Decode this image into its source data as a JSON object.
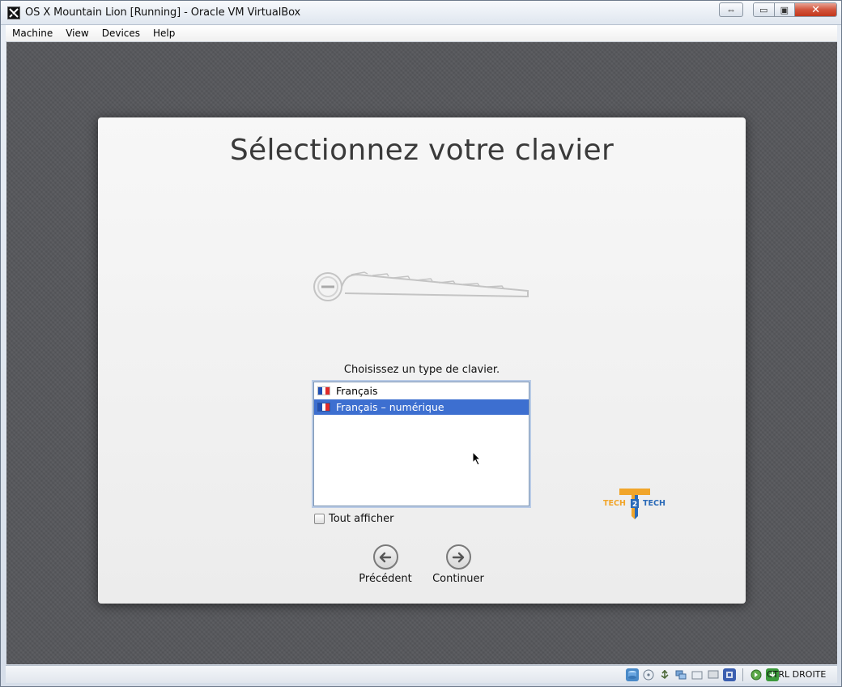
{
  "window": {
    "title": "OS X Mountain Lion [Running] - Oracle VM VirtualBox",
    "icon": "virtualbox-icon",
    "controls": {
      "resize": "⇔",
      "minimize": "▭",
      "maximize": "▣",
      "close": "✕"
    }
  },
  "menubar": {
    "items": [
      {
        "label": "Machine"
      },
      {
        "label": "View"
      },
      {
        "label": "Devices"
      },
      {
        "label": "Help"
      }
    ]
  },
  "installer": {
    "title": "Sélectionnez votre clavier",
    "prompt": "Choisissez un type de clavier.",
    "keyboard_types": [
      {
        "label": "Français",
        "selected": false
      },
      {
        "label": "Français – numérique",
        "selected": true
      }
    ],
    "show_all_label": "Tout afficher",
    "show_all_checked": false,
    "back_label": "Précédent",
    "continue_label": "Continuer"
  },
  "watermark": {
    "left": "TECH",
    "middle": "2",
    "right": "TECH"
  },
  "statusbar": {
    "host_key": "CTRL DROITE",
    "icons": [
      "hard-disk-icon",
      "optical-drive-icon",
      "usb-icon",
      "network-icon",
      "shared-folders-icon",
      "display-icon",
      "video-capture-icon",
      "mouse-integration-icon",
      "host-key-icon"
    ]
  },
  "colors": {
    "selection": "#3d6fd0",
    "guest_background": "#56575b",
    "panel": "#f2f2f2",
    "close_button": "#c2371c"
  }
}
